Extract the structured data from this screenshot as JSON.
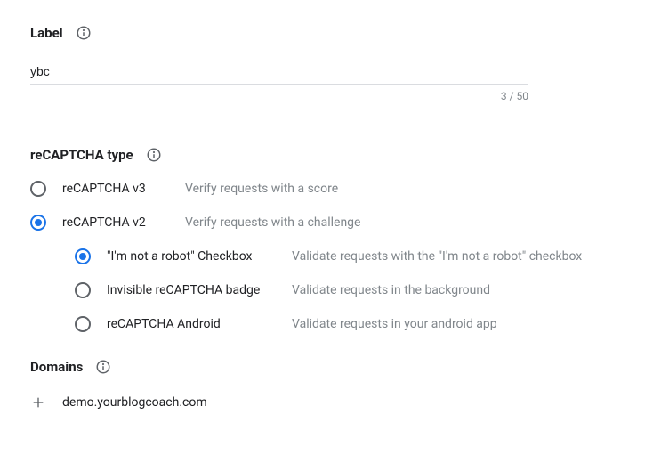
{
  "label": {
    "title": "Label",
    "value": "ybc",
    "counter": "3 / 50"
  },
  "type": {
    "title": "reCAPTCHA type",
    "options": [
      {
        "label": "reCAPTCHA v3",
        "desc": "Verify requests with a score"
      },
      {
        "label": "reCAPTCHA v2",
        "desc": "Verify requests with a challenge"
      }
    ],
    "sub_options": [
      {
        "label": "\"I'm not a robot\" Checkbox",
        "desc": "Validate requests with the \"I'm not a robot\" checkbox"
      },
      {
        "label": "Invisible reCAPTCHA badge",
        "desc": "Validate requests in the background"
      },
      {
        "label": "reCAPTCHA Android",
        "desc": "Validate requests in your android app"
      }
    ]
  },
  "domains": {
    "title": "Domains",
    "entry": "demo.yourblogcoach.com"
  }
}
